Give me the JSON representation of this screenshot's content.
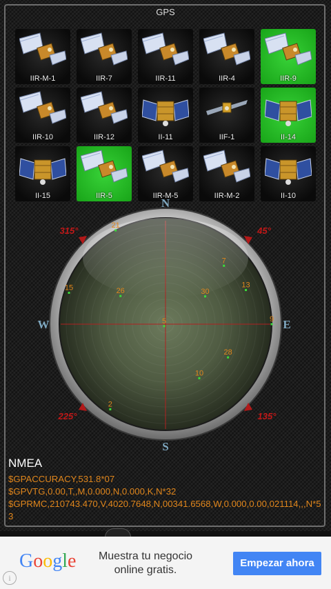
{
  "app": {
    "title": "GPS"
  },
  "satellites": [
    {
      "label": "IIR-M-1",
      "active": false,
      "style": "wing"
    },
    {
      "label": "IIR-7",
      "active": false,
      "style": "wing"
    },
    {
      "label": "IIR-11",
      "active": false,
      "style": "wing"
    },
    {
      "label": "IIR-4",
      "active": false,
      "style": "wing"
    },
    {
      "label": "IIR-9",
      "active": true,
      "style": "wing"
    },
    {
      "label": "IIR-10",
      "active": false,
      "style": "wing"
    },
    {
      "label": "IIR-12",
      "active": false,
      "style": "wing"
    },
    {
      "label": "II-11",
      "active": false,
      "style": "box"
    },
    {
      "label": "IIF-1",
      "active": false,
      "style": "flat"
    },
    {
      "label": "II-14",
      "active": true,
      "style": "box"
    },
    {
      "label": "II-15",
      "active": false,
      "style": "box"
    },
    {
      "label": "IIR-5",
      "active": true,
      "style": "wing"
    },
    {
      "label": "IIR-M-5",
      "active": false,
      "style": "wing"
    },
    {
      "label": "IIR-M-2",
      "active": false,
      "style": "wing"
    },
    {
      "label": "II-10",
      "active": false,
      "style": "box"
    }
  ],
  "compass": {
    "north": "N",
    "east": "E",
    "south": "S",
    "west": "W",
    "bearing_ne": "45°",
    "bearing_se": "135°",
    "bearing_sw": "225°",
    "bearing_nw": "315°",
    "satellite_points": [
      {
        "id": "21",
        "azimuth": 332,
        "elevation": 0
      },
      {
        "id": "7",
        "azimuth": 45,
        "elevation": 20
      },
      {
        "id": "30",
        "azimuth": 55,
        "elevation": 49
      },
      {
        "id": "13",
        "azimuth": 67,
        "elevation": 16
      },
      {
        "id": "26",
        "azimuth": 302,
        "elevation": 45
      },
      {
        "id": "15",
        "azimuth": 288,
        "elevation": 4
      },
      {
        "id": "9",
        "azimuth": 90,
        "elevation": 0
      },
      {
        "id": "5",
        "azimuth": 214,
        "elevation": 88
      },
      {
        "id": "28",
        "azimuth": 118,
        "elevation": 30
      },
      {
        "id": "10",
        "azimuth": 148,
        "elevation": 36
      },
      {
        "id": "2",
        "azimuth": 213,
        "elevation": 4
      }
    ],
    "colors": {
      "label": "#e0861c",
      "dot": "#3bdc3b",
      "crosshair": "#b02020",
      "bearing": "#c01818"
    }
  },
  "nmea": {
    "heading": "NMEA",
    "lines": [
      "$GPACCURACY,531.8*07",
      "$GPVTG,0.00,T,,M,0.000,N,0.000,K,N*32",
      "$GPRMC,210743.470,V,4020.7648,N,00341.6568,W,0.000,0.00,021114,,,N*53"
    ]
  },
  "ad": {
    "brand": "Google",
    "message": "Muestra tu negocio online gratis.",
    "cta": "Empezar ahora",
    "info_glyph": "i"
  }
}
